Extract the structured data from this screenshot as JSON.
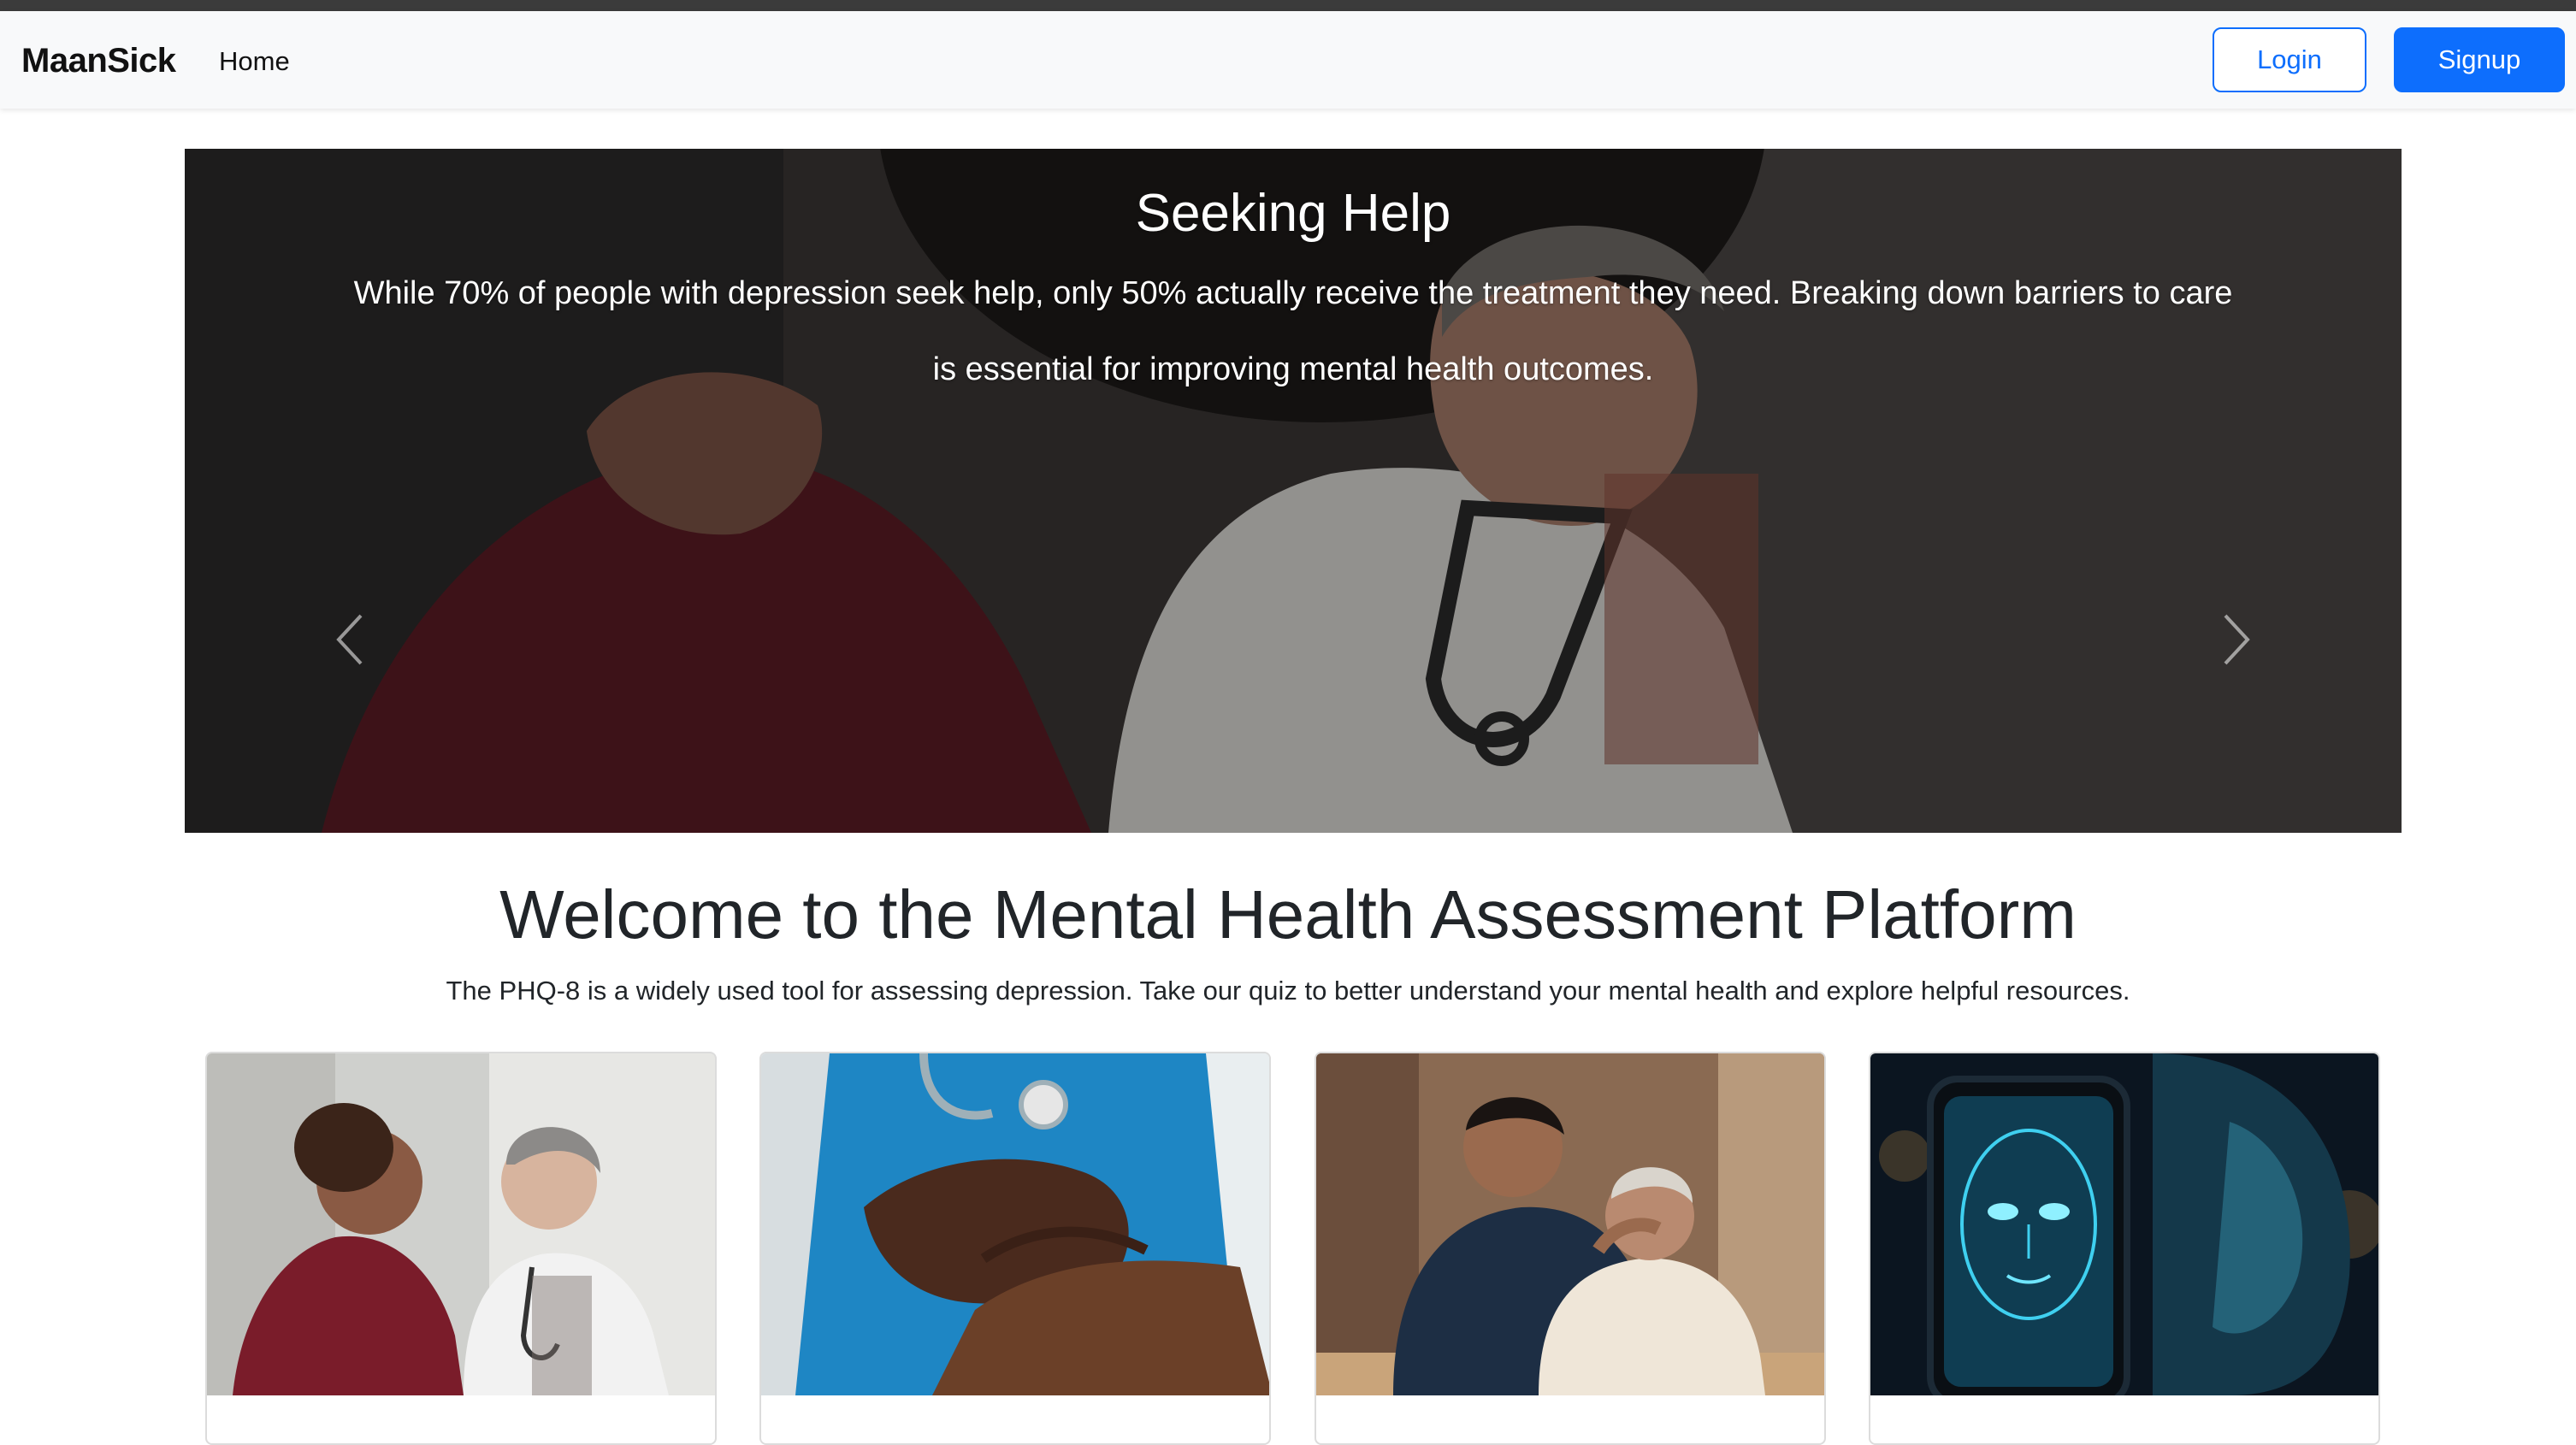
{
  "nav": {
    "brand": "MaanSick",
    "home_label": "Home",
    "login_label": "Login",
    "signup_label": "Signup"
  },
  "carousel": {
    "title": "Seeking Help",
    "text": "While 70% of people with depression seek help, only 50% actually receive the treatment they need. Breaking down barriers to care is essential for improving mental health outcomes.",
    "prev_icon": "chevron-left-icon",
    "next_icon": "chevron-right-icon"
  },
  "welcome": {
    "title": "Welcome to the Mental Health Assessment Platform",
    "subtitle": "The PHQ-8 is a widely used tool for assessing depression. Take our quiz to better understand your mental health and explore helpful resources."
  },
  "colors": {
    "primary": "#0d6efd",
    "navbar_bg": "#f8f9fa",
    "text": "#212529"
  }
}
